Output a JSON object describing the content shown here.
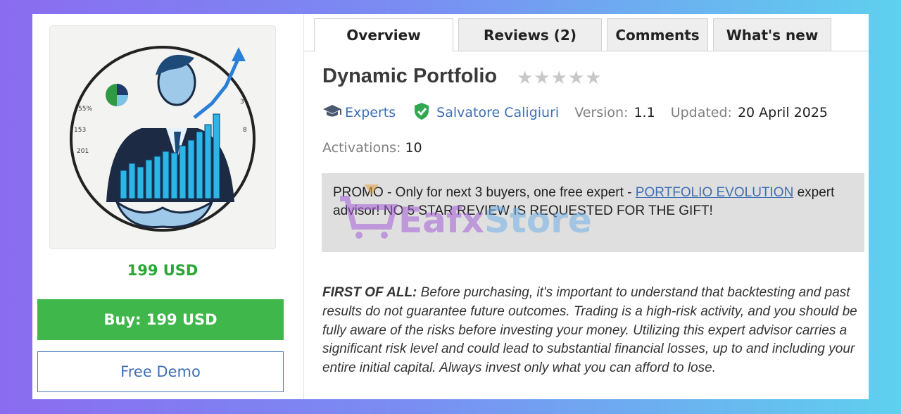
{
  "product": {
    "image_alt": "man in suit holding rising bar chart",
    "price": "199 USD",
    "buy_label": "Buy: 199 USD",
    "demo_label": "Free Demo"
  },
  "tabs": [
    {
      "label": "Overview"
    },
    {
      "label": "Reviews (2)"
    },
    {
      "label": "Comments"
    },
    {
      "label": "What's new"
    }
  ],
  "header": {
    "title": "Dynamic Portfolio",
    "stars": "★★★★★",
    "category": "Experts",
    "author": "Salvatore Caligiuri",
    "version_label": "Version:",
    "version_value": "1.1",
    "updated_label": "Updated:",
    "updated_value": "20 April 2025",
    "activations_label": "Activations:",
    "activations_value": "10"
  },
  "promo": {
    "prefix": "PROMO - Only for next 3 buyers, one free expert - ",
    "link_text": "PORTFOLIO EVOLUTION",
    "suffix": " expert advisor! NO 5 STAR REVIEW IS REQUESTED FOR THE GIFT!"
  },
  "watermark": {
    "brand_a": "Eafx",
    "brand_b": "Store"
  },
  "description": {
    "lead": "FIRST OF ALL:",
    "body": " Before purchasing, it's important to understand that backtesting and past results do not guarantee future outcomes. Trading is a high-risk activity, and you should be fully aware of the risks before investing your money. Utilizing this expert advisor carries a significant risk level and could lead to substantial financial losses, up to and including your entire initial capital. Always invest only what you can afford to lose."
  },
  "colors": {
    "accent_green": "#3fb74a",
    "link_blue": "#3e6fb4",
    "promo_bg": "#dfdfdf"
  }
}
